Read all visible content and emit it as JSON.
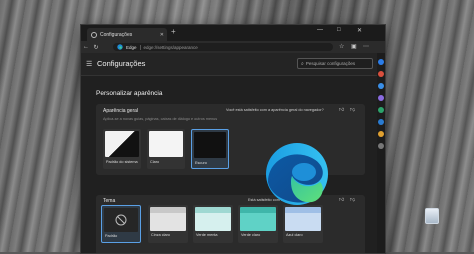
{
  "window": {
    "tab_title": "Configurações",
    "new_tab_glyph": "+",
    "controls": {
      "minimize": "—",
      "maximize": "□",
      "close": "✕"
    }
  },
  "toolbar": {
    "browser_label": "Edge",
    "url": "edge://settings/appearance"
  },
  "settings": {
    "title": "Configurações",
    "search_placeholder": "Pesquisar configurações",
    "section_title": "Personalizar aparência"
  },
  "appearance": {
    "title": "Aparência geral",
    "description": "Aplica-se a novas guias, páginas, caixas de diálogo e outros menus",
    "question": "Você está satisfeito com a aparência geral do navegador?",
    "options": [
      {
        "label": "Padrão do sistema",
        "selected": false
      },
      {
        "label": "Claro",
        "selected": false
      },
      {
        "label": "Escuro",
        "selected": true
      }
    ]
  },
  "theme": {
    "title": "Tema",
    "question": "Está satisfeito com os temas?",
    "options": [
      {
        "label": "Padrão",
        "selected": true
      },
      {
        "label": "Cinza claro",
        "selected": false
      },
      {
        "label": "Verde menta",
        "selected": false
      },
      {
        "label": "Verde claro",
        "selected": false
      },
      {
        "label": "Azul claro",
        "selected": false
      }
    ]
  },
  "colors": {
    "accent": "#5aa0e6",
    "window_bg": "#202020",
    "card_bg": "#2b2b2b"
  },
  "icons": [
    "back-icon",
    "refresh-icon",
    "edge-logo-icon",
    "favorites-icon",
    "collections-icon",
    "more-icon",
    "search-icon",
    "menu-icon",
    "thumbs-up-icon",
    "thumbs-down-icon",
    "recycle-bin-icon",
    "bing-icon"
  ]
}
